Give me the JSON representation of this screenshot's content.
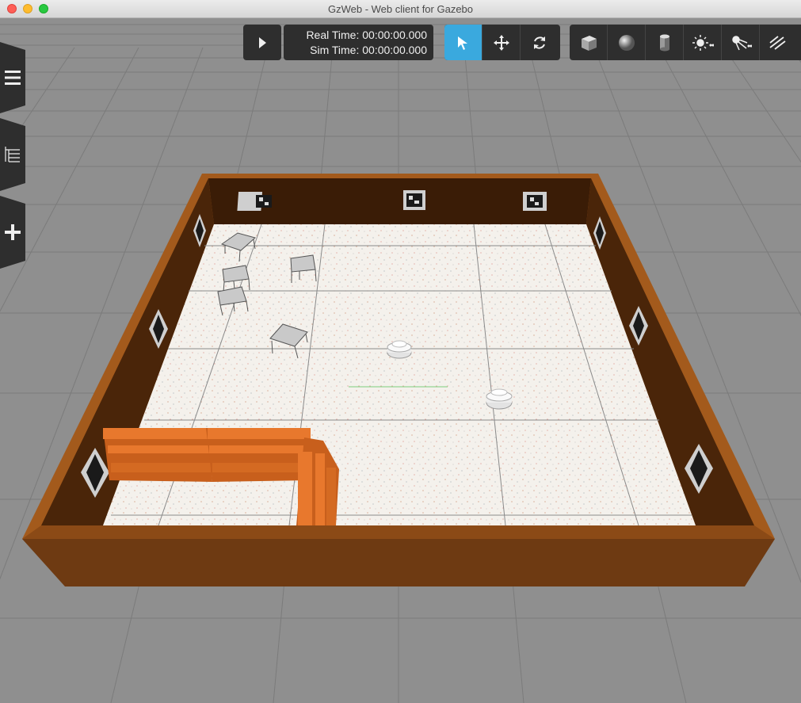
{
  "window": {
    "title": "GzWeb - Web client for Gazebo"
  },
  "toolbar": {
    "play_icon": "play-icon",
    "real_time_label": "Real Time:",
    "real_time_value": "00:00:00.000",
    "sim_time_label": "Sim Time:",
    "sim_time_value": "00:00:00.000",
    "modes": [
      "select-icon",
      "translate-icon",
      "rotate-icon"
    ],
    "active_mode": "select-icon",
    "shapes": [
      "box-icon",
      "sphere-icon",
      "cylinder-icon",
      "point-light-icon",
      "spot-light-icon",
      "directional-light-icon"
    ],
    "active_color": "#3aa9de",
    "panel_color": "#2e2e2e"
  },
  "sidebar": {
    "tabs": [
      "menu-icon",
      "tree-icon",
      "insert-icon"
    ]
  },
  "scene": {
    "ground_color": "#8e8e8e",
    "wall_color": "#6e3a12",
    "shelf_color": "#e6772a"
  }
}
